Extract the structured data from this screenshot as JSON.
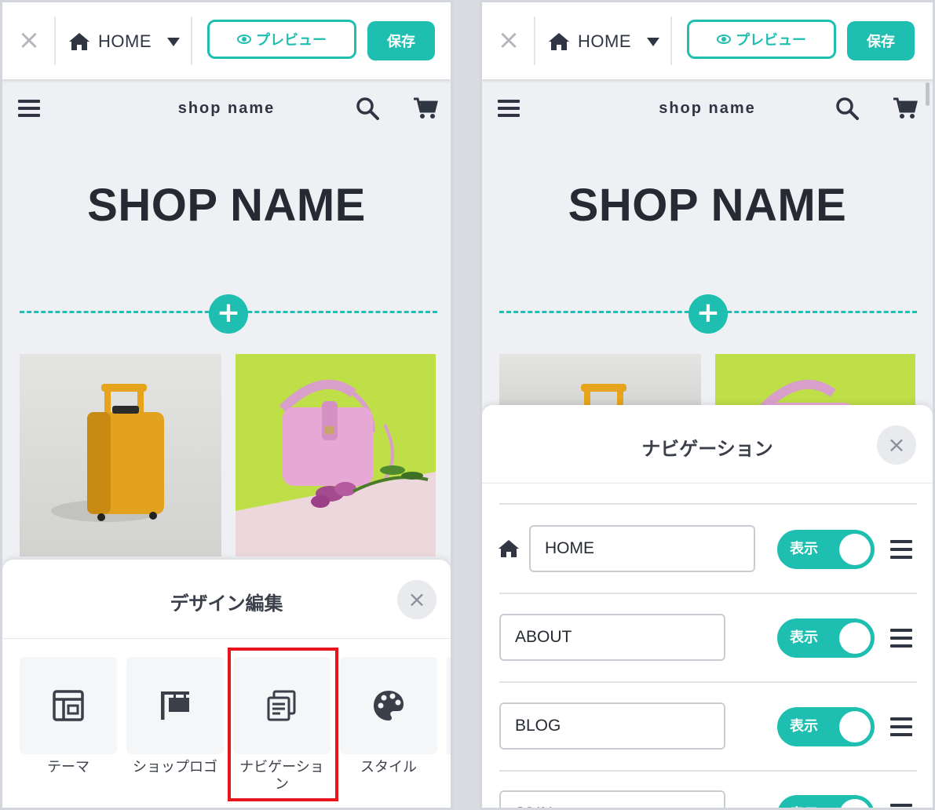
{
  "editor_bar": {
    "close_label": "×",
    "page_selector_label": "HOME",
    "preview_label": "プレビュー",
    "save_label": "保存"
  },
  "shop": {
    "header_name": "shop name",
    "title": "SHOP NAME"
  },
  "design_sheet": {
    "title": "デザイン編集",
    "close_label": "×",
    "items": [
      {
        "label": "テーマ",
        "icon": "layout-icon"
      },
      {
        "label": "ショップロゴ",
        "icon": "signboard-icon"
      },
      {
        "label": "ナビゲーション",
        "icon": "navigation-icon",
        "highlighted": true
      },
      {
        "label": "スタイル",
        "icon": "palette-icon"
      }
    ]
  },
  "navigation_sheet": {
    "title": "ナビゲーション",
    "close_label": "×",
    "toggle_label": "表示",
    "rows": [
      {
        "value": "HOME",
        "visible": true
      },
      {
        "value": "ABOUT",
        "visible": true
      },
      {
        "value": "BLOG",
        "visible": true
      },
      {
        "value": "JOIN",
        "visible": true
      }
    ]
  },
  "colors": {
    "accent": "#1ebfb0",
    "highlight": "#e8161b",
    "text": "#2f3542"
  }
}
